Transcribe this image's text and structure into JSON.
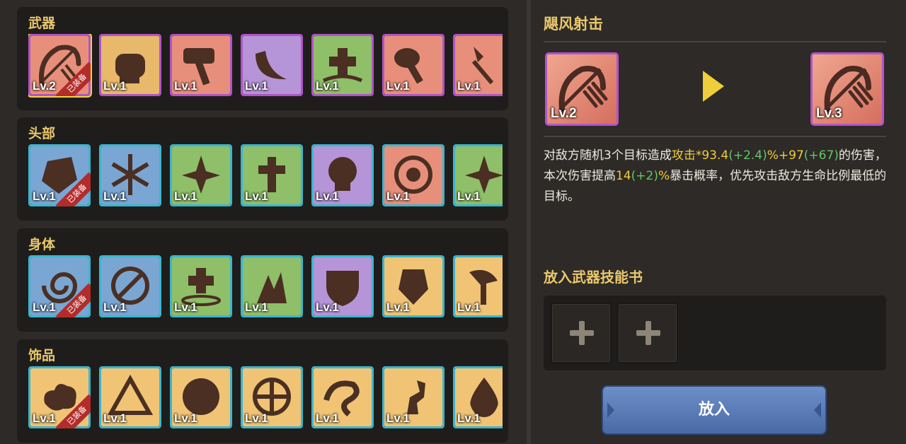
{
  "sections": [
    {
      "title": "武器",
      "frame_color": "#b054c8",
      "tiles": [
        {
          "icon": "bow-icon",
          "level": "Lv.2",
          "bg": "#e88f7b",
          "equipped": true,
          "selected": true
        },
        {
          "icon": "fist-icon",
          "level": "Lv.1",
          "bg": "#e8b96a",
          "equipped": false
        },
        {
          "icon": "hammer-icon",
          "level": "Lv.1",
          "bg": "#e88f7b",
          "equipped": false
        },
        {
          "icon": "horn-icon",
          "level": "Lv.1",
          "bg": "#b694d8",
          "equipped": false
        },
        {
          "icon": "heal-plus-icon",
          "level": "Lv.1",
          "bg": "#8fbf68",
          "equipped": false
        },
        {
          "icon": "club-icon",
          "level": "Lv.1",
          "bg": "#e88f7b",
          "equipped": false
        },
        {
          "icon": "spear-icon",
          "level": "Lv.1",
          "bg": "#e88f7b",
          "equipped": false
        }
      ]
    },
    {
      "title": "头部",
      "frame_color": "#3bb6cf",
      "tiles": [
        {
          "icon": "ice-crystal-icon",
          "level": "Lv.1",
          "bg": "#7aa6d4",
          "equipped": true
        },
        {
          "icon": "snowflake-icon",
          "level": "Lv.1",
          "bg": "#7aa6d4",
          "equipped": false
        },
        {
          "icon": "sparkle-ripple-icon",
          "level": "Lv.1",
          "bg": "#8fbf68",
          "equipped": false
        },
        {
          "icon": "cross-icon",
          "level": "Lv.1",
          "bg": "#8fbf68",
          "equipped": false
        },
        {
          "icon": "skull-icon",
          "level": "Lv.1",
          "bg": "#b694d8",
          "equipped": false
        },
        {
          "icon": "target-icon",
          "level": "Lv.1",
          "bg": "#e88f7b",
          "equipped": false
        },
        {
          "icon": "star-icon",
          "level": "Lv.1",
          "bg": "#8fbf68",
          "equipped": false
        }
      ]
    },
    {
      "title": "身体",
      "frame_color": "#3bb6cf",
      "tiles": [
        {
          "icon": "vortex-icon",
          "level": "Lv.1",
          "bg": "#7aa6d4",
          "equipped": true
        },
        {
          "icon": "no-entry-icon",
          "level": "Lv.1",
          "bg": "#7aa6d4",
          "equipped": false
        },
        {
          "icon": "heal-ripple-icon",
          "level": "Lv.1",
          "bg": "#8fbf68",
          "equipped": false
        },
        {
          "icon": "regen-hand-icon",
          "level": "Lv.1",
          "bg": "#8fbf68",
          "equipped": false
        },
        {
          "icon": "broken-shield-icon",
          "level": "Lv.1",
          "bg": "#b694d8",
          "equipped": false
        },
        {
          "icon": "crest-icon",
          "level": "Lv.1",
          "bg": "#f0c474",
          "equipped": false
        },
        {
          "icon": "axe-icon",
          "level": "Lv.1",
          "bg": "#f0c474",
          "equipped": false
        }
      ]
    },
    {
      "title": "饰品",
      "frame_color": "#3bb6cf",
      "tiles": [
        {
          "icon": "cloud-icon",
          "level": "Lv.1",
          "bg": "#f0c474",
          "equipped": true
        },
        {
          "icon": "pyramid-icon",
          "level": "Lv.1",
          "bg": "#f0c474",
          "equipped": false
        },
        {
          "icon": "sphere-icon",
          "level": "Lv.1",
          "bg": "#f0c474",
          "equipped": false
        },
        {
          "icon": "ball-icon",
          "level": "Lv.1",
          "bg": "#f0c474",
          "equipped": false
        },
        {
          "icon": "swirl-icon",
          "level": "Lv.1",
          "bg": "#f0c474",
          "equipped": false
        },
        {
          "icon": "runner-icon",
          "level": "Lv.1",
          "bg": "#f0c474",
          "equipped": false
        },
        {
          "icon": "drop-icon",
          "level": "Lv.1",
          "bg": "#f0c474",
          "equipped": false
        }
      ]
    }
  ],
  "equipped_label": "已装备",
  "detail": {
    "title": "飓风射击",
    "from_level": "Lv.2",
    "to_level": "Lv.3",
    "icon": "bow-icon",
    "desc": {
      "p1": "对敌方随机3个目标造成",
      "p2": "攻击*93.4",
      "p3": "(+2.4)",
      "p4": "%+97",
      "p5": "(+67)",
      "p6": "的伤害，本次伤害提高",
      "p7": "14",
      "p8": "(+2)",
      "p9": "%",
      "p10": "暴击概率，优先攻击敌方生命比例最低的目标。"
    }
  },
  "book": {
    "title": "放入武器技能书",
    "slots": [
      "plus-icon",
      "plus-icon"
    ]
  },
  "put_button": "放入",
  "colors": {
    "accent_yellow": "#f0cd3a",
    "bonus_green": "#63c766",
    "title_gold": "#e9c86d"
  }
}
